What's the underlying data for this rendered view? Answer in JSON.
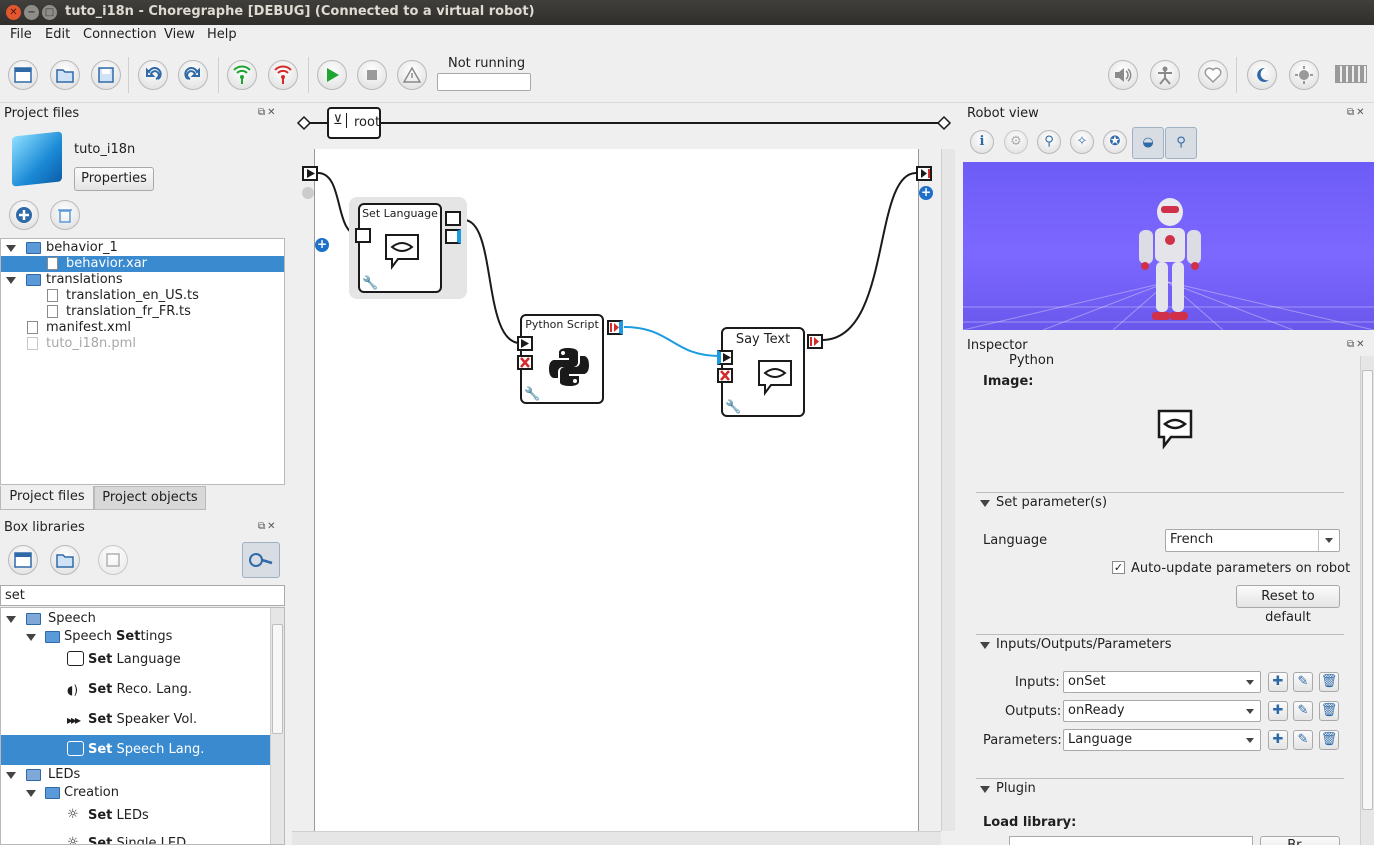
{
  "window": {
    "title": "tuto_i18n - Choregraphe [DEBUG] (Connected to a virtual robot)"
  },
  "menu": [
    "File",
    "Edit",
    "Connection",
    "View",
    "Help"
  ],
  "toolbar": {
    "status_label": "Not running",
    "status_value": ""
  },
  "project_files": {
    "title": "Project files",
    "project_name": "tuto_i18n",
    "properties_label": "Properties",
    "tree": [
      {
        "label": "behavior_1",
        "type": "folder",
        "level": 0
      },
      {
        "label": "behavior.xar",
        "type": "file",
        "level": 1,
        "selected": true
      },
      {
        "label": "translations",
        "type": "folder",
        "level": 0
      },
      {
        "label": "translation_en_US.ts",
        "type": "file",
        "level": 1
      },
      {
        "label": "translation_fr_FR.ts",
        "type": "file",
        "level": 1
      },
      {
        "label": "manifest.xml",
        "type": "file",
        "level": 0
      },
      {
        "label": "tuto_i18n.pml",
        "type": "file",
        "level": 0,
        "dimmed": true
      }
    ],
    "tabs": [
      "Project files",
      "Project objects"
    ]
  },
  "box_libraries": {
    "title": "Box libraries",
    "search_value": "set",
    "tree": [
      {
        "label": "Speech",
        "bold": "",
        "level": 0
      },
      {
        "label": "Speech ",
        "bold": "Set",
        "rest": "tings",
        "level": 1
      },
      {
        "bold": "Set",
        "label": " Language",
        "level": 2
      },
      {
        "bold": "Set",
        "label": " Reco. Lang.",
        "level": 2
      },
      {
        "bold": "Set",
        "label": " Speaker Vol.",
        "level": 2
      },
      {
        "bold": "Set",
        "label": " Speech Lang.",
        "level": 2,
        "selected": true
      },
      {
        "label": "LEDs",
        "level": 0
      },
      {
        "label": "Creation",
        "level": 1
      },
      {
        "bold": "Set",
        "label": " LEDs",
        "level": 2
      },
      {
        "bold": "Set",
        "label": " Single LED",
        "level": 2
      }
    ]
  },
  "flow": {
    "root_label": "root",
    "boxes": {
      "set_language": "Set Language",
      "python_script": "Python Script",
      "say_text": "Say Text"
    }
  },
  "robot_view": {
    "title": "Robot view"
  },
  "inspector": {
    "title": "Inspector",
    "python_label": "Python",
    "image_label": "Image:",
    "sections": {
      "params": "Set parameter(s)",
      "io": "Inputs/Outputs/Parameters",
      "plugin": "Plugin"
    },
    "language_label": "Language",
    "language_value": "French",
    "auto_update_label": "Auto-update parameters on robot",
    "reset_label": "Reset to default",
    "inputs_label": "Inputs:",
    "inputs_value": "onSet",
    "outputs_label": "Outputs:",
    "outputs_value": "onReady",
    "parameters_label": "Parameters:",
    "parameters_value": "Language",
    "load_library_label": "Load library:",
    "browse_label": "Br..."
  },
  "colors": {
    "accent": "#3a8ad0",
    "robot_bg": "#6f5cf5",
    "link_blue": "#1d9be0"
  }
}
